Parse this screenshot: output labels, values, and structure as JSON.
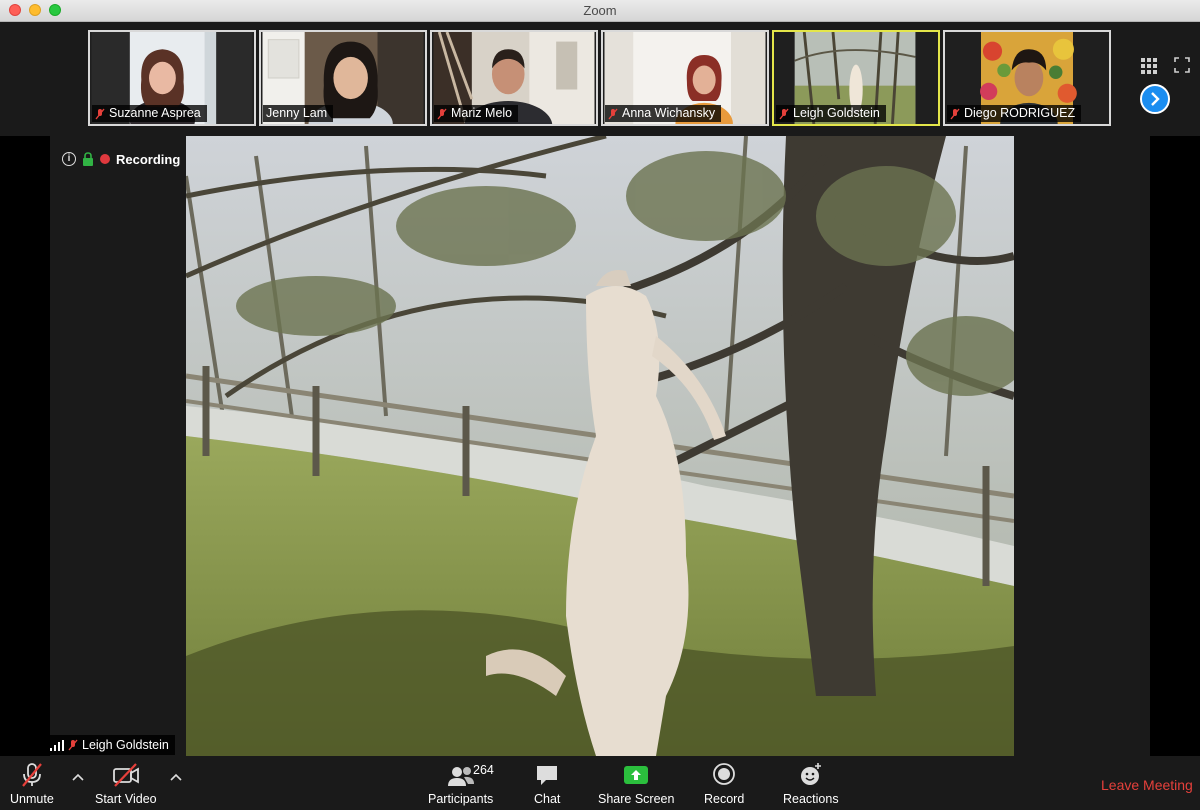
{
  "window": {
    "title": "Zoom"
  },
  "participants_strip": [
    {
      "name": "Suzanne Asprea",
      "muted": true,
      "active": false
    },
    {
      "name": "Jenny Lam",
      "muted": false,
      "active": false
    },
    {
      "name": "Mariz Melo",
      "muted": true,
      "active": false
    },
    {
      "name": "Anna Wichansky",
      "muted": true,
      "active": false
    },
    {
      "name": "Leigh Goldstein",
      "muted": true,
      "active": true
    },
    {
      "name": "Diego RODRIGUEZ",
      "muted": true,
      "active": false
    }
  ],
  "meeting_info": {
    "recording_label": "Recording"
  },
  "active_speaker": {
    "name": "Leigh Goldstein",
    "muted": true
  },
  "toolbar": {
    "unmute_label": "Unmute",
    "start_video_label": "Start Video",
    "participants_label": "Participants",
    "participants_count": "264",
    "chat_label": "Chat",
    "share_screen_label": "Share Screen",
    "record_label": "Record",
    "reactions_label": "Reactions",
    "leave_label": "Leave Meeting"
  },
  "colors": {
    "accent": "#1b8df0",
    "recording": "#e0393e",
    "leave": "#e5403b",
    "share": "#2bbf3d",
    "active_border": "#e4e64a"
  }
}
